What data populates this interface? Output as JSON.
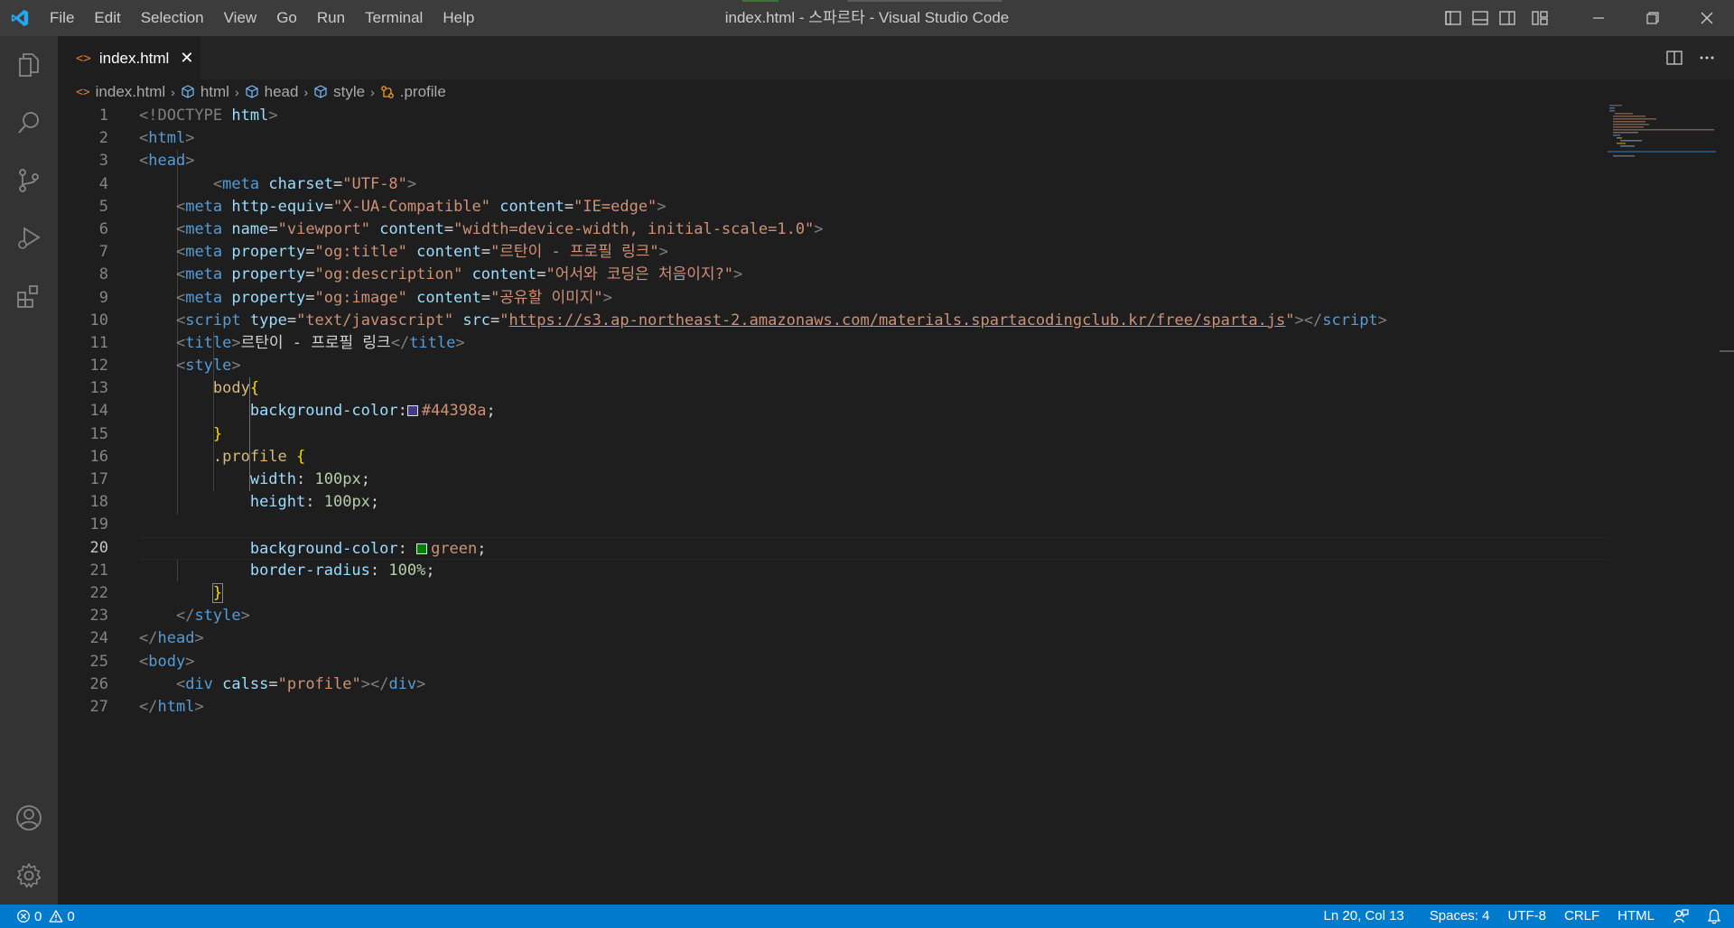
{
  "window": {
    "title": "index.html - 스파르타 - Visual Studio Code",
    "menu": [
      "File",
      "Edit",
      "Selection",
      "View",
      "Go",
      "Run",
      "Terminal",
      "Help"
    ]
  },
  "activity_bar": {
    "items": [
      "files-icon",
      "search-icon",
      "source-control-icon",
      "run-debug-icon",
      "extensions-icon"
    ],
    "bottom": [
      "account-icon",
      "manage-gear-icon"
    ]
  },
  "tab": {
    "icon": "<>",
    "label": "index.html",
    "close": "✕"
  },
  "breadcrumb": {
    "file": "index.html",
    "items": [
      "html",
      "head",
      "style",
      ".profile"
    ]
  },
  "editor": {
    "current_line": 20,
    "line_numbers": [
      "1",
      "2",
      "3",
      "4",
      "5",
      "6",
      "7",
      "8",
      "9",
      "10",
      "11",
      "12",
      "13",
      "14",
      "15",
      "16",
      "17",
      "18",
      "19",
      "20",
      "21",
      "22",
      "23",
      "24",
      "25",
      "26",
      "27"
    ],
    "swatch_colors": {
      "purple": "#44398a",
      "green": "#008000"
    }
  },
  "status_bar": {
    "errors": "0",
    "warnings": "0",
    "position": "Ln 20, Col 13",
    "spaces": "Spaces: 4",
    "encoding": "UTF-8",
    "eol": "CRLF",
    "language": "HTML"
  },
  "colors": {
    "status_bar": "#007acc",
    "title_bar": "#3c3c3c",
    "activity_bar": "#333333",
    "editor_bg": "#1e1e1e"
  }
}
